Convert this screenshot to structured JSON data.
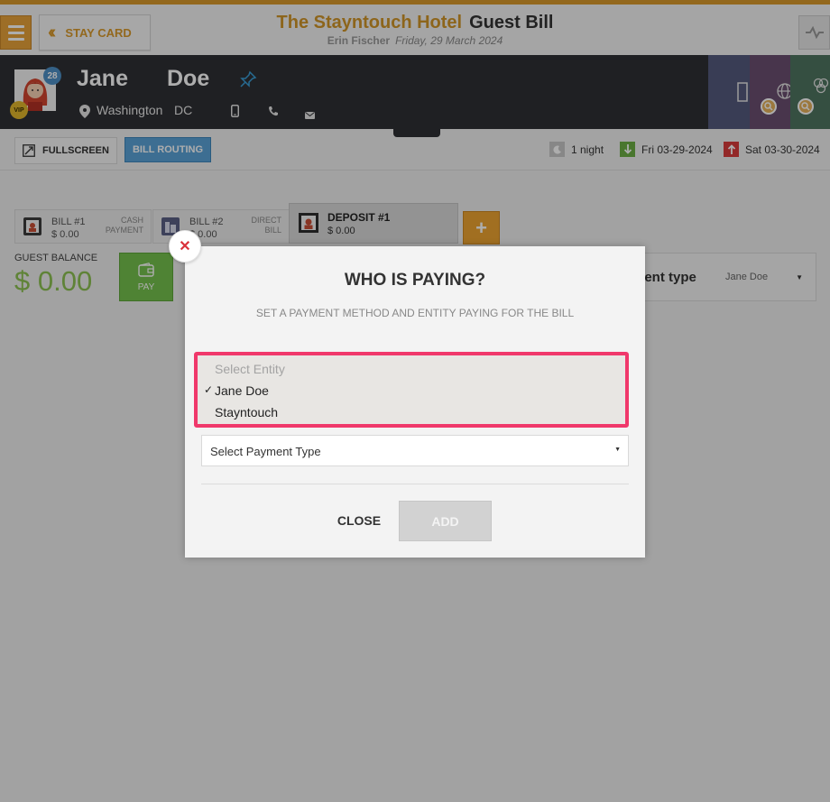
{
  "topbar": {
    "stay_card_label": "STAY CARD",
    "hotel_name": "The Stayntouch Hotel",
    "page_title": "Guest Bill",
    "user_name": "Erin Fischer",
    "business_date": "Friday, 29 March 2024"
  },
  "guest": {
    "first_name": "Jane",
    "last_name": "Doe",
    "city": "Washington",
    "state": "DC",
    "badge_count": "28",
    "vip_label": "VIP"
  },
  "toolbar": {
    "fullscreen_label": "FULLSCREEN",
    "bill_routing_label": "BILL ROUTING",
    "nights": "1 night",
    "arrival": "Fri 03-29-2024",
    "departure": "Sat 03-30-2024"
  },
  "bills": [
    {
      "name": "BILL #1",
      "amount": "$ 0.00",
      "type_line1": "CASH",
      "type_line2": "PAYMENT"
    },
    {
      "name": "BILL #2",
      "amount": "$ 0.00",
      "type_line1": "DIRECT",
      "type_line2": "BILL"
    },
    {
      "name": "DEPOSIT #1",
      "amount": "$ 0.00"
    }
  ],
  "add_bill_label": "+",
  "balance": {
    "label": "GUEST BALANCE",
    "value": "$ 0.00",
    "pay_label": "PAY"
  },
  "payment_panel": {
    "title": "ment type",
    "value": "Jane Doe"
  },
  "modal": {
    "title": "WHO IS PAYING?",
    "subtitle": "SET A PAYMENT METHOD AND ENTITY PAYING FOR THE BILL",
    "entity_placeholder": "Select Entity",
    "entity_options": [
      "Jane Doe",
      "Stayntouch"
    ],
    "selected_entity": "Jane Doe",
    "payment_type_value": "Select Payment Type",
    "close_label": "CLOSE",
    "add_label": "ADD"
  },
  "colors": {
    "accent": "#d99a2b",
    "highlight": "#f0386b",
    "balance_green": "#8cc152",
    "bill_routing_blue": "#5aa3d8"
  }
}
